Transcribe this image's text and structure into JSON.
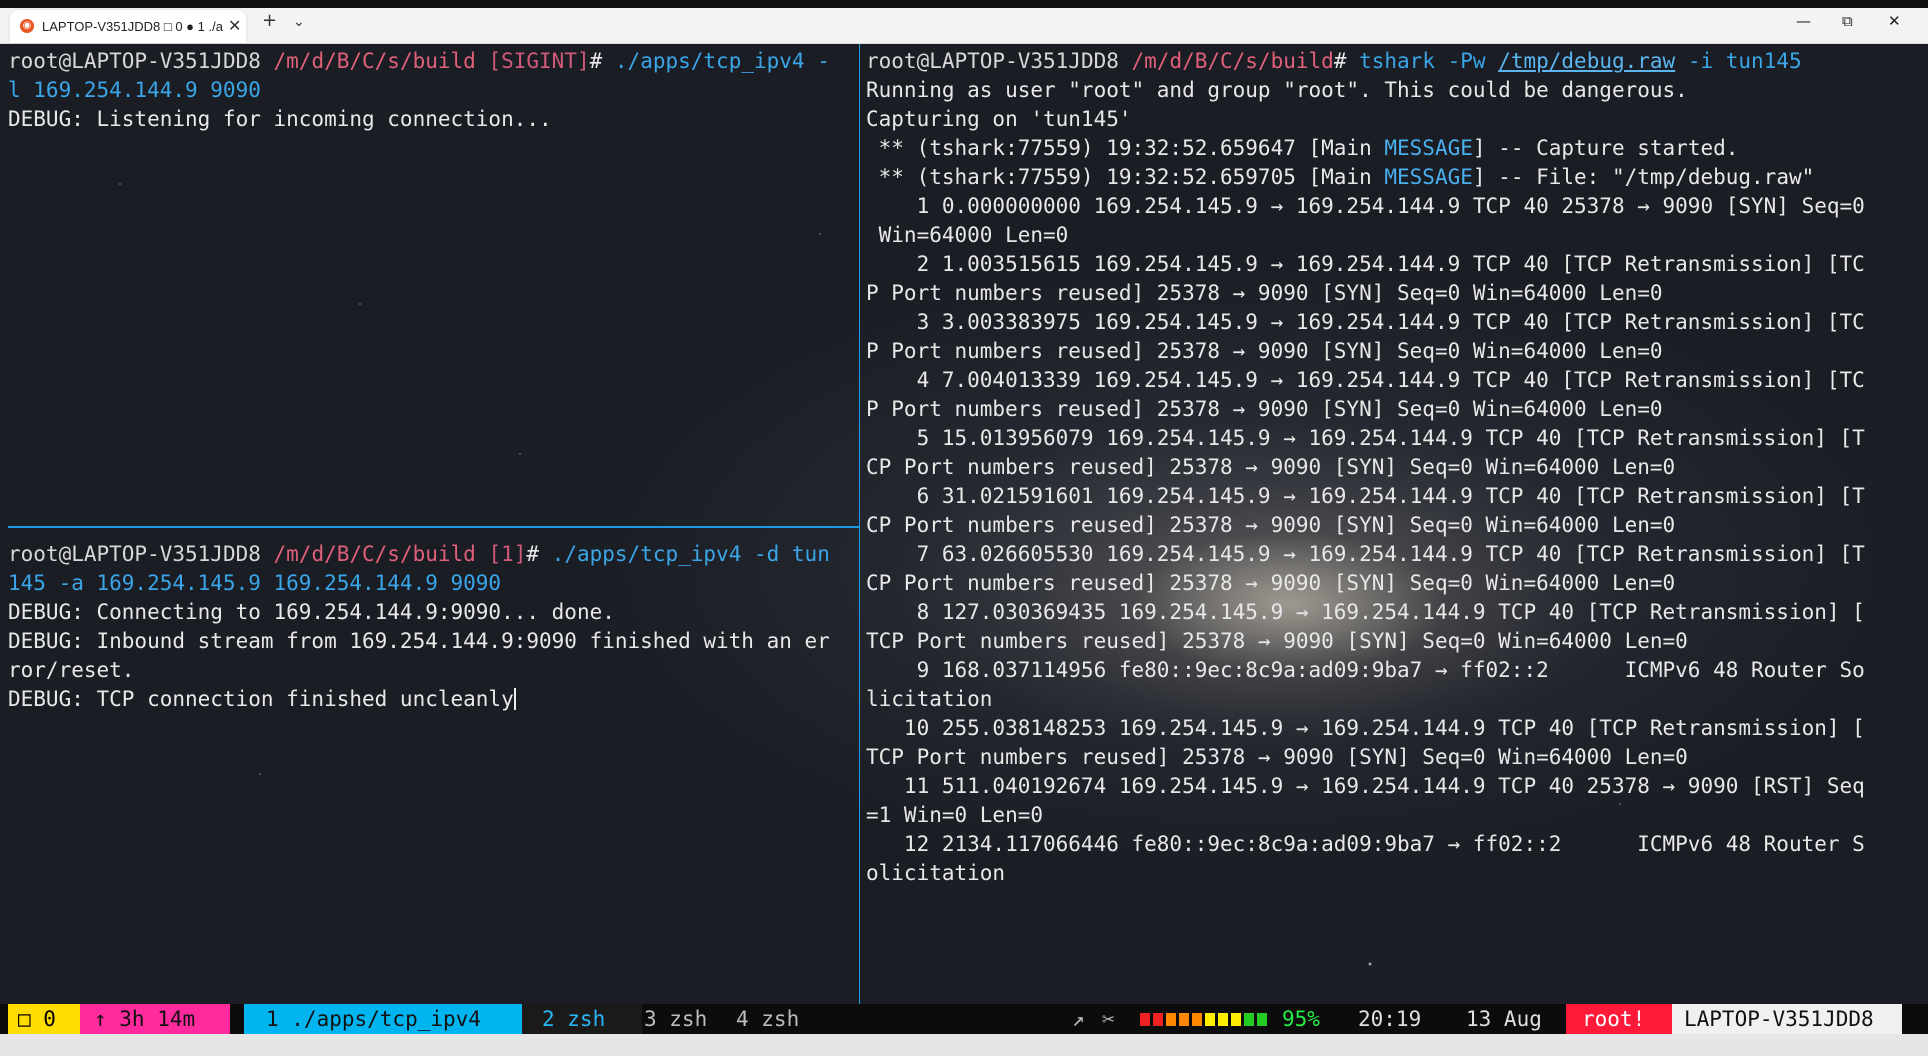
{
  "window": {
    "tab_title": "LAPTOP-V351JDD8 □ 0 ● 1 ./a",
    "new_tab_glyph": "+",
    "dropdown_glyph": "⌄",
    "minimize_glyph": "—",
    "maximize_glyph": "⧉",
    "close_glyph": "✕",
    "tab_close_glyph": "✕"
  },
  "left_top_pane": {
    "prompt_user": "root",
    "prompt_host": "@LAPTOP-V351JDD8",
    "prompt_path": " /m/d/B/C/s/build",
    "prompt_flag": " [SIGINT]",
    "prompt_char": "# ",
    "command": "./apps/tcp_ipv4 -",
    "command_cont": "l 169.254.144.9 9090",
    "output": [
      "DEBUG: Listening for incoming connection..."
    ]
  },
  "left_bottom_pane": {
    "prompt_user": "root",
    "prompt_host": "@LAPTOP-V351JDD8",
    "prompt_path": " /m/d/B/C/s/build",
    "prompt_flag": " [1]",
    "prompt_char": "# ",
    "command": "./apps/tcp_ipv4 -d tun",
    "command_cont": "145 -a 169.254.145.9 169.254.144.9 9090",
    "output": [
      "DEBUG: Connecting to 169.254.144.9:9090... done.",
      "DEBUG: Inbound stream from 169.254.144.9:9090 finished with an er",
      "ror/reset.",
      "DEBUG: TCP connection finished uncleanly"
    ]
  },
  "right_pane": {
    "prompt_user": "root",
    "prompt_host": "@LAPTOP-V351JDD8",
    "prompt_path": " /m/d/B/C/s/build",
    "prompt_char": "# ",
    "command_a": "tshark -Pw ",
    "command_file": "/tmp/debug.raw",
    "command_b": " -i tun145",
    "output": [
      "Running as user \"root\" and group \"root\". This could be dangerous.",
      "Capturing on 'tun145'",
      " ** (tshark:77559) 19:32:52.659647 [Main ",
      " ** (tshark:77559) 19:32:52.659705 [Main ",
      "    1 0.000000000 169.254.145.9 → 169.254.144.9 TCP 40 25378 → 9090 [SYN] Seq=0",
      " Win=64000 Len=0",
      "    2 1.003515615 169.254.145.9 → 169.254.144.9 TCP 40 [TCP Retransmission] [TC",
      "P Port numbers reused] 25378 → 9090 [SYN] Seq=0 Win=64000 Len=0",
      "    3 3.003383975 169.254.145.9 → 169.254.144.9 TCP 40 [TCP Retransmission] [TC",
      "P Port numbers reused] 25378 → 9090 [SYN] Seq=0 Win=64000 Len=0",
      "    4 7.004013339 169.254.145.9 → 169.254.144.9 TCP 40 [TCP Retransmission] [TC",
      "P Port numbers reused] 25378 → 9090 [SYN] Seq=0 Win=64000 Len=0",
      "    5 15.013956079 169.254.145.9 → 169.254.144.9 TCP 40 [TCP Retransmission] [T",
      "CP Port numbers reused] 25378 → 9090 [SYN] Seq=0 Win=64000 Len=0",
      "    6 31.021591601 169.254.145.9 → 169.254.144.9 TCP 40 [TCP Retransmission] [T",
      "CP Port numbers reused] 25378 → 9090 [SYN] Seq=0 Win=64000 Len=0",
      "    7 63.026605530 169.254.145.9 → 169.254.144.9 TCP 40 [TCP Retransmission] [T",
      "CP Port numbers reused] 25378 → 9090 [SYN] Seq=0 Win=64000 Len=0",
      "    8 127.030369435 169.254.145.9 → 169.254.144.9 TCP 40 [TCP Retransmission] [",
      "TCP Port numbers reused] 25378 → 9090 [SYN] Seq=0 Win=64000 Len=0",
      "    9 168.037114956 fe80::9ec:8c9a:ad09:9ba7 → ff02::2      ICMPv6 48 Router So",
      "licitation",
      "   10 255.038148253 169.254.145.9 → 169.254.144.9 TCP 40 [TCP Retransmission] [",
      "TCP Port numbers reused] 25378 → 9090 [SYN] Seq=0 Win=64000 Len=0",
      "   11 511.040192674 169.254.145.9 → 169.254.144.9 TCP 40 25378 → 9090 [RST] Seq",
      "=1 Win=0 Len=0",
      "   12 2134.117066446 fe80::9ec:8c9a:ad09:9ba7 → ff02::2      ICMPv6 48 Router S",
      "olicitation"
    ],
    "message_word": "MESSAGE",
    "message_tail_1": "] -- Capture started.",
    "message_tail_2": "] -- File: \"/tmp/debug.raw\""
  },
  "statusbar": {
    "session": "□ 0",
    "uptime": "↑ 3h 14m",
    "window_1": "1 ./apps/tcp_ipv4",
    "window_2": "2 zsh",
    "window_3": "3 zsh",
    "window_4": "4 zsh",
    "arrow_glyph": "↗",
    "plug_glyph": "✂",
    "battery_percent": "95%",
    "battery_level": 0.95,
    "time": "20:19",
    "date": "13 Aug",
    "root_flag": "root!",
    "hostname": "LAPTOP-V351JDD8",
    "colors": {
      "yellow": "#ffdd00",
      "pink": "#ff2a9d",
      "cyan": "#00b4f0",
      "red": "#ff1a3a",
      "battery_green": "#22cc22",
      "battery_red": "#ee2222",
      "battery_orange": "#ff8800",
      "battery_yellow": "#ffee00"
    }
  }
}
